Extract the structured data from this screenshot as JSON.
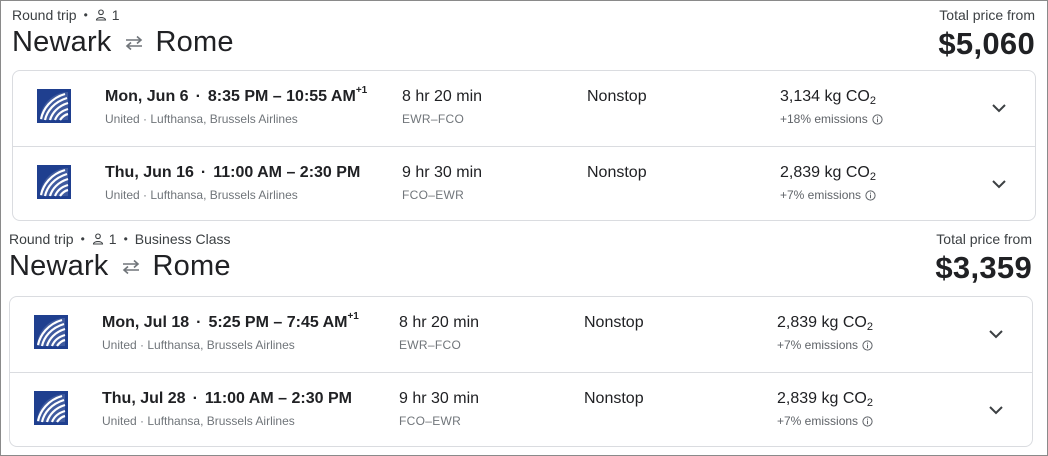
{
  "trips": [
    {
      "trip_type": "Round trip",
      "passengers": "1",
      "cabin": "",
      "origin": "Newark",
      "destination": "Rome",
      "total_label": "Total price from",
      "price": "$5,060",
      "flights": [
        {
          "date": "Mon, Jun 6",
          "times": "8:35 PM – 10:55 AM",
          "day_offset": "+1",
          "airlines": "United · Lufthansa, Brussels Airlines",
          "duration": "8 hr 20 min",
          "airports": "EWR–FCO",
          "stops": "Nonstop",
          "co2": "3,134 kg CO",
          "co2_sub": "2",
          "emissions": "+18% emissions"
        },
        {
          "date": "Thu, Jun 16",
          "times": "11:00 AM – 2:30 PM",
          "day_offset": "",
          "airlines": "United · Lufthansa, Brussels Airlines",
          "duration": "9 hr 30 min",
          "airports": "FCO–EWR",
          "stops": "Nonstop",
          "co2": "2,839 kg CO",
          "co2_sub": "2",
          "emissions": "+7% emissions"
        }
      ]
    },
    {
      "trip_type": "Round trip",
      "passengers": "1",
      "cabin": "Business Class",
      "origin": "Newark",
      "destination": "Rome",
      "total_label": "Total price from",
      "price": "$3,359",
      "flights": [
        {
          "date": "Mon, Jul 18",
          "times": "5:25 PM – 7:45 AM",
          "day_offset": "+1",
          "airlines": "United · Lufthansa, Brussels Airlines",
          "duration": "8 hr 20 min",
          "airports": "EWR–FCO",
          "stops": "Nonstop",
          "co2": "2,839 kg CO",
          "co2_sub": "2",
          "emissions": "+7% emissions"
        },
        {
          "date": "Thu, Jul 28",
          "times": "11:00 AM – 2:30 PM",
          "day_offset": "",
          "airlines": "United · Lufthansa, Brussels Airlines",
          "duration": "9 hr 30 min",
          "airports": "FCO–EWR",
          "stops": "Nonstop",
          "co2": "2,839 kg CO",
          "co2_sub": "2",
          "emissions": "+7% emissions"
        }
      ]
    }
  ],
  "icons": {
    "person": "person-icon",
    "swap": "round-trip-arrows-icon",
    "airline_logo": "united-airlines-logo-icon",
    "info": "info-icon",
    "expand": "chevron-down-icon"
  },
  "colors": {
    "text": "#202124",
    "secondary": "#70757a",
    "divider": "#dadce0",
    "united_blue": "#1f3f8f"
  }
}
